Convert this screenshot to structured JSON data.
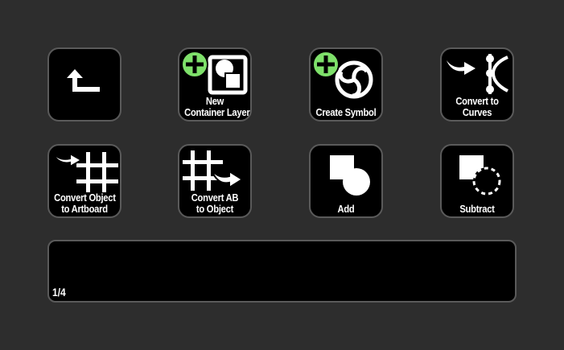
{
  "keys": {
    "back": {
      "icon": "arrow-up-left-icon"
    },
    "new_container": {
      "line1": "New",
      "line2": "Container Layer",
      "icon": "new-container-layer-icon"
    },
    "create_symbol": {
      "line1": "Create Symbol",
      "icon": "create-symbol-icon"
    },
    "convert_curves": {
      "line1": "Convert to",
      "line2": "Curves",
      "icon": "convert-to-curves-icon"
    },
    "convert_object_artboard": {
      "line1": "Convert Object",
      "line2": "to Artboard",
      "icon": "convert-object-to-artboard-icon"
    },
    "convert_ab_object": {
      "line1": "Convert AB",
      "line2": "to Object",
      "icon": "convert-artboard-to-object-icon"
    },
    "add": {
      "line1": "Add",
      "icon": "boolean-add-icon"
    },
    "subtract": {
      "line1": "Subtract",
      "icon": "boolean-subtract-icon"
    }
  },
  "pager": {
    "text": "1/4"
  },
  "colors": {
    "accent_green": "#7ee06a",
    "background": "#2d2d2d",
    "key_bg": "#000000",
    "key_border": "#5a5a5a"
  }
}
